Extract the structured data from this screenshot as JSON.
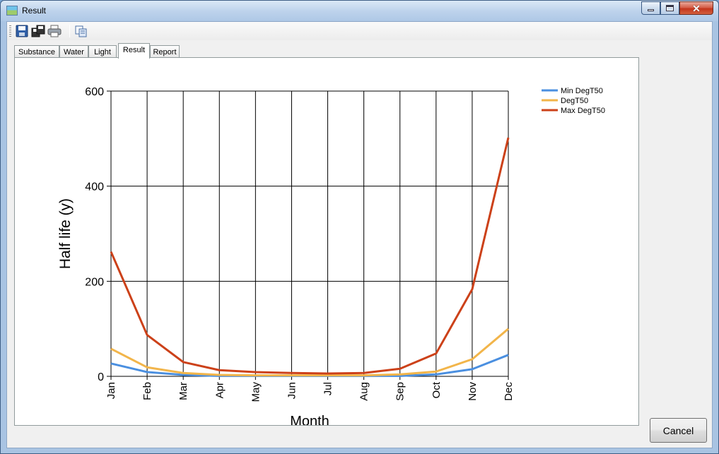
{
  "window": {
    "title": "Result"
  },
  "toolbar": {
    "icons": [
      "save-icon",
      "save-all-icon",
      "print-icon",
      "copy-icon"
    ]
  },
  "tabs": [
    {
      "label": "Substance",
      "active": false
    },
    {
      "label": "Water",
      "active": false
    },
    {
      "label": "Light",
      "active": false
    },
    {
      "label": "Result",
      "active": true
    },
    {
      "label": "Report",
      "active": false
    }
  ],
  "buttons": {
    "cancel_label": "Cancel"
  },
  "chart_data": {
    "type": "line",
    "title": "",
    "xlabel": "Month",
    "ylabel": "Half life (y)",
    "categories": [
      "Jan",
      "Feb",
      "Mar",
      "Apr",
      "May",
      "Jun",
      "Jul",
      "Aug",
      "Sep",
      "Oct",
      "Nov",
      "Dec"
    ],
    "ylim": [
      0,
      600
    ],
    "yticks": [
      "0",
      "200",
      "400",
      "600"
    ],
    "grid": true,
    "legend": "top-right",
    "series": [
      {
        "name": "Min DegT50",
        "color": "#4a8fe0",
        "values": [
          27,
          9,
          3,
          1,
          1,
          1,
          1,
          1,
          1,
          4,
          15,
          45
        ]
      },
      {
        "name": "DegT50",
        "color": "#f2b54a",
        "values": [
          58,
          19,
          7,
          3,
          2,
          2,
          2,
          2,
          4,
          10,
          36,
          100
        ]
      },
      {
        "name": "Max DegT50",
        "color": "#cc4119",
        "values": [
          262,
          87,
          30,
          13,
          9,
          7,
          6,
          7,
          16,
          48,
          183,
          502
        ]
      }
    ]
  }
}
